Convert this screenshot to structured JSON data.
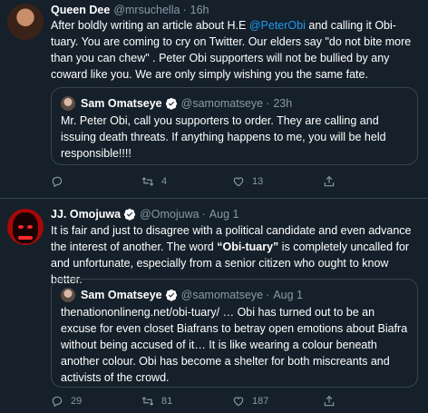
{
  "tweets": [
    {
      "name": "Queen Dee",
      "handle": "@mrsuchella",
      "time": "16h",
      "text_pre": "After boldly writing an article about H.E ",
      "mention": "@PeterObi",
      "text_post": " and calling it Obi-tuary. You are coming to cry on Twitter. Our elders say \"do not bite more than you can chew\" . Peter Obi supporters will not be bullied by any coward like you. We are only simply wishing you the same fate.",
      "quote": {
        "name": "Sam Omatseye",
        "handle": "@samomatseye",
        "time": "23h",
        "text": "Mr. Peter Obi, call you supporters to order. They are calling and issuing death threats. If anything happens to me, you will be held responsible!!!!"
      },
      "actions": {
        "replies": "",
        "retweets": "4",
        "likes": "13"
      }
    },
    {
      "name": "JJ. Omojuwa",
      "handle": "@Omojuwa",
      "time": "Aug 1",
      "text_pre": "It is fair and just to disagree with a political candidate and even advance the interest of another. The word ",
      "text_bold": "“Obi-tuary”",
      "text_post": " is completely uncalled for and unfortunate, especially from a senior citizen who ought to know better.",
      "quote": {
        "name": "Sam Omatseye",
        "handle": "@samomatseye",
        "time": "Aug 1",
        "text": "thenationonlineng.net/obi-tuary/ … Obi has turned out to be an excuse for even closet Biafrans to betray open emotions about Biafra without being accused of it… It is like wearing a colour beneath another colour. Obi has become a shelter for both miscreants and activists of the crowd."
      },
      "actions": {
        "replies": "29",
        "retweets": "81",
        "likes": "187"
      }
    }
  ],
  "colors": {
    "background": "#15202b",
    "muted": "#8899a6",
    "accent": "#1d9bf0",
    "border": "#38444d"
  },
  "icons": [
    "reply-icon",
    "retweet-icon",
    "like-icon",
    "share-icon",
    "verified-icon"
  ]
}
